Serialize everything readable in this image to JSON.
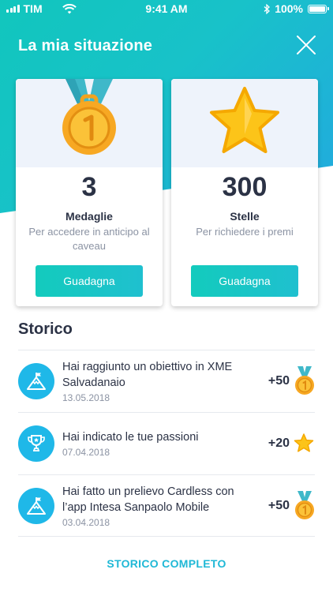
{
  "status_bar": {
    "carrier": "TIM",
    "time": "9:41 AM",
    "battery": "100%"
  },
  "header": {
    "title": "La mia situazione"
  },
  "cards": {
    "medals": {
      "value": "3",
      "name": "Medaglie",
      "description": "Per accedere in anticipo al caveau",
      "button": "Guadagna"
    },
    "stars": {
      "value": "300",
      "name": "Stelle",
      "description": "Per richiedere i premi",
      "button": "Guadagna"
    }
  },
  "history": {
    "title": "Storico",
    "items": [
      {
        "title": "Hai raggiunto un obiettivo in XME Salvadanaio",
        "date": "13.05.2018",
        "points": "+50",
        "icon": "mountain-flag-icon",
        "badge": "medal-icon"
      },
      {
        "title": "Hai indicato le tue passioni",
        "date": "07.04.2018",
        "points": "+20",
        "icon": "trophy-icon",
        "badge": "star-icon"
      },
      {
        "title": "Hai fatto un prelievo Cardless con l’app Intesa Sanpaolo Mobile",
        "date": "03.04.2018",
        "points": "+50",
        "icon": "mountain-flag-icon",
        "badge": "medal-icon"
      }
    ],
    "full_link": "STORICO COMPLETO"
  },
  "colors": {
    "accent": "#1fb8d6",
    "hero_start": "#11c6bd",
    "hero_end": "#22a9df",
    "button": "#13cbbd",
    "text": "#2b3245",
    "muted": "#8b93a3",
    "medal": "#f5a623",
    "star": "#fcc419"
  }
}
